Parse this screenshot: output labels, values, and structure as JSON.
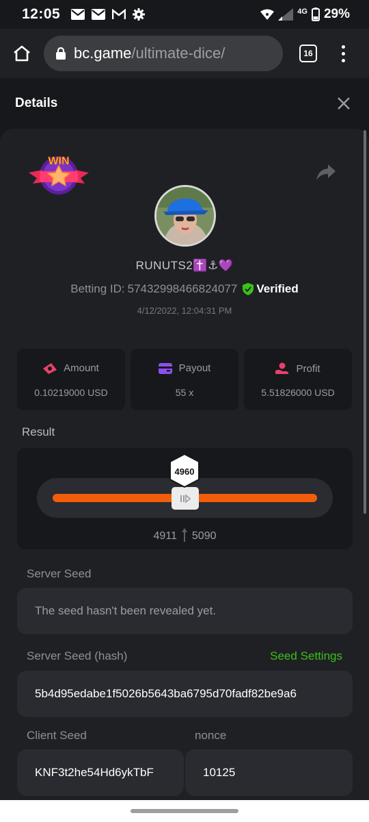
{
  "status_bar": {
    "time": "12:05",
    "network": "4G",
    "battery": "29%",
    "left_icons": [
      "mail-icon",
      "mail-icon",
      "gmail-icon",
      "gear-icon"
    ],
    "right_icons": [
      "wifi-icon",
      "signal-icon",
      "battery-icon"
    ]
  },
  "browser": {
    "url_host": "bc.game",
    "url_path": "/ultimate-dice/",
    "tab_count": "16"
  },
  "details": {
    "title": "Details"
  },
  "bet": {
    "username": "RUNUTS2✝️⚓💜",
    "betting_id_label": "Betting ID:",
    "betting_id": "57432998466824077",
    "verified": "Verified",
    "timestamp": "4/12/2022, 12:04:31 PM"
  },
  "stats": [
    {
      "label": "Amount",
      "value": "0.10219000 USD",
      "icon": "money-icon",
      "color": "#e8416b"
    },
    {
      "label": "Payout",
      "value": "55 x",
      "icon": "card-icon",
      "color": "#8b4ff0"
    },
    {
      "label": "Profit",
      "value": "5.51826000 USD",
      "icon": "profit-hand-icon",
      "color": "#e8416b"
    }
  ],
  "result": {
    "label": "Result",
    "value": "4960",
    "range_low": "4911",
    "range_high": "5090",
    "accent": "#f25d0c"
  },
  "seeds": {
    "server_seed_label": "Server Seed",
    "server_seed_value": "The seed hasn't been revealed yet.",
    "server_seed_hash_label": "Server Seed (hash)",
    "seed_settings": "Seed Settings",
    "server_seed_hash": "5b4d95edabe1f5026b5643ba6795d70fadf82be9a6",
    "client_seed_label": "Client Seed",
    "client_seed_value": "KNF3t2he54Hd6ykTbF",
    "nonce_label": "nonce",
    "nonce_value": "10125"
  }
}
